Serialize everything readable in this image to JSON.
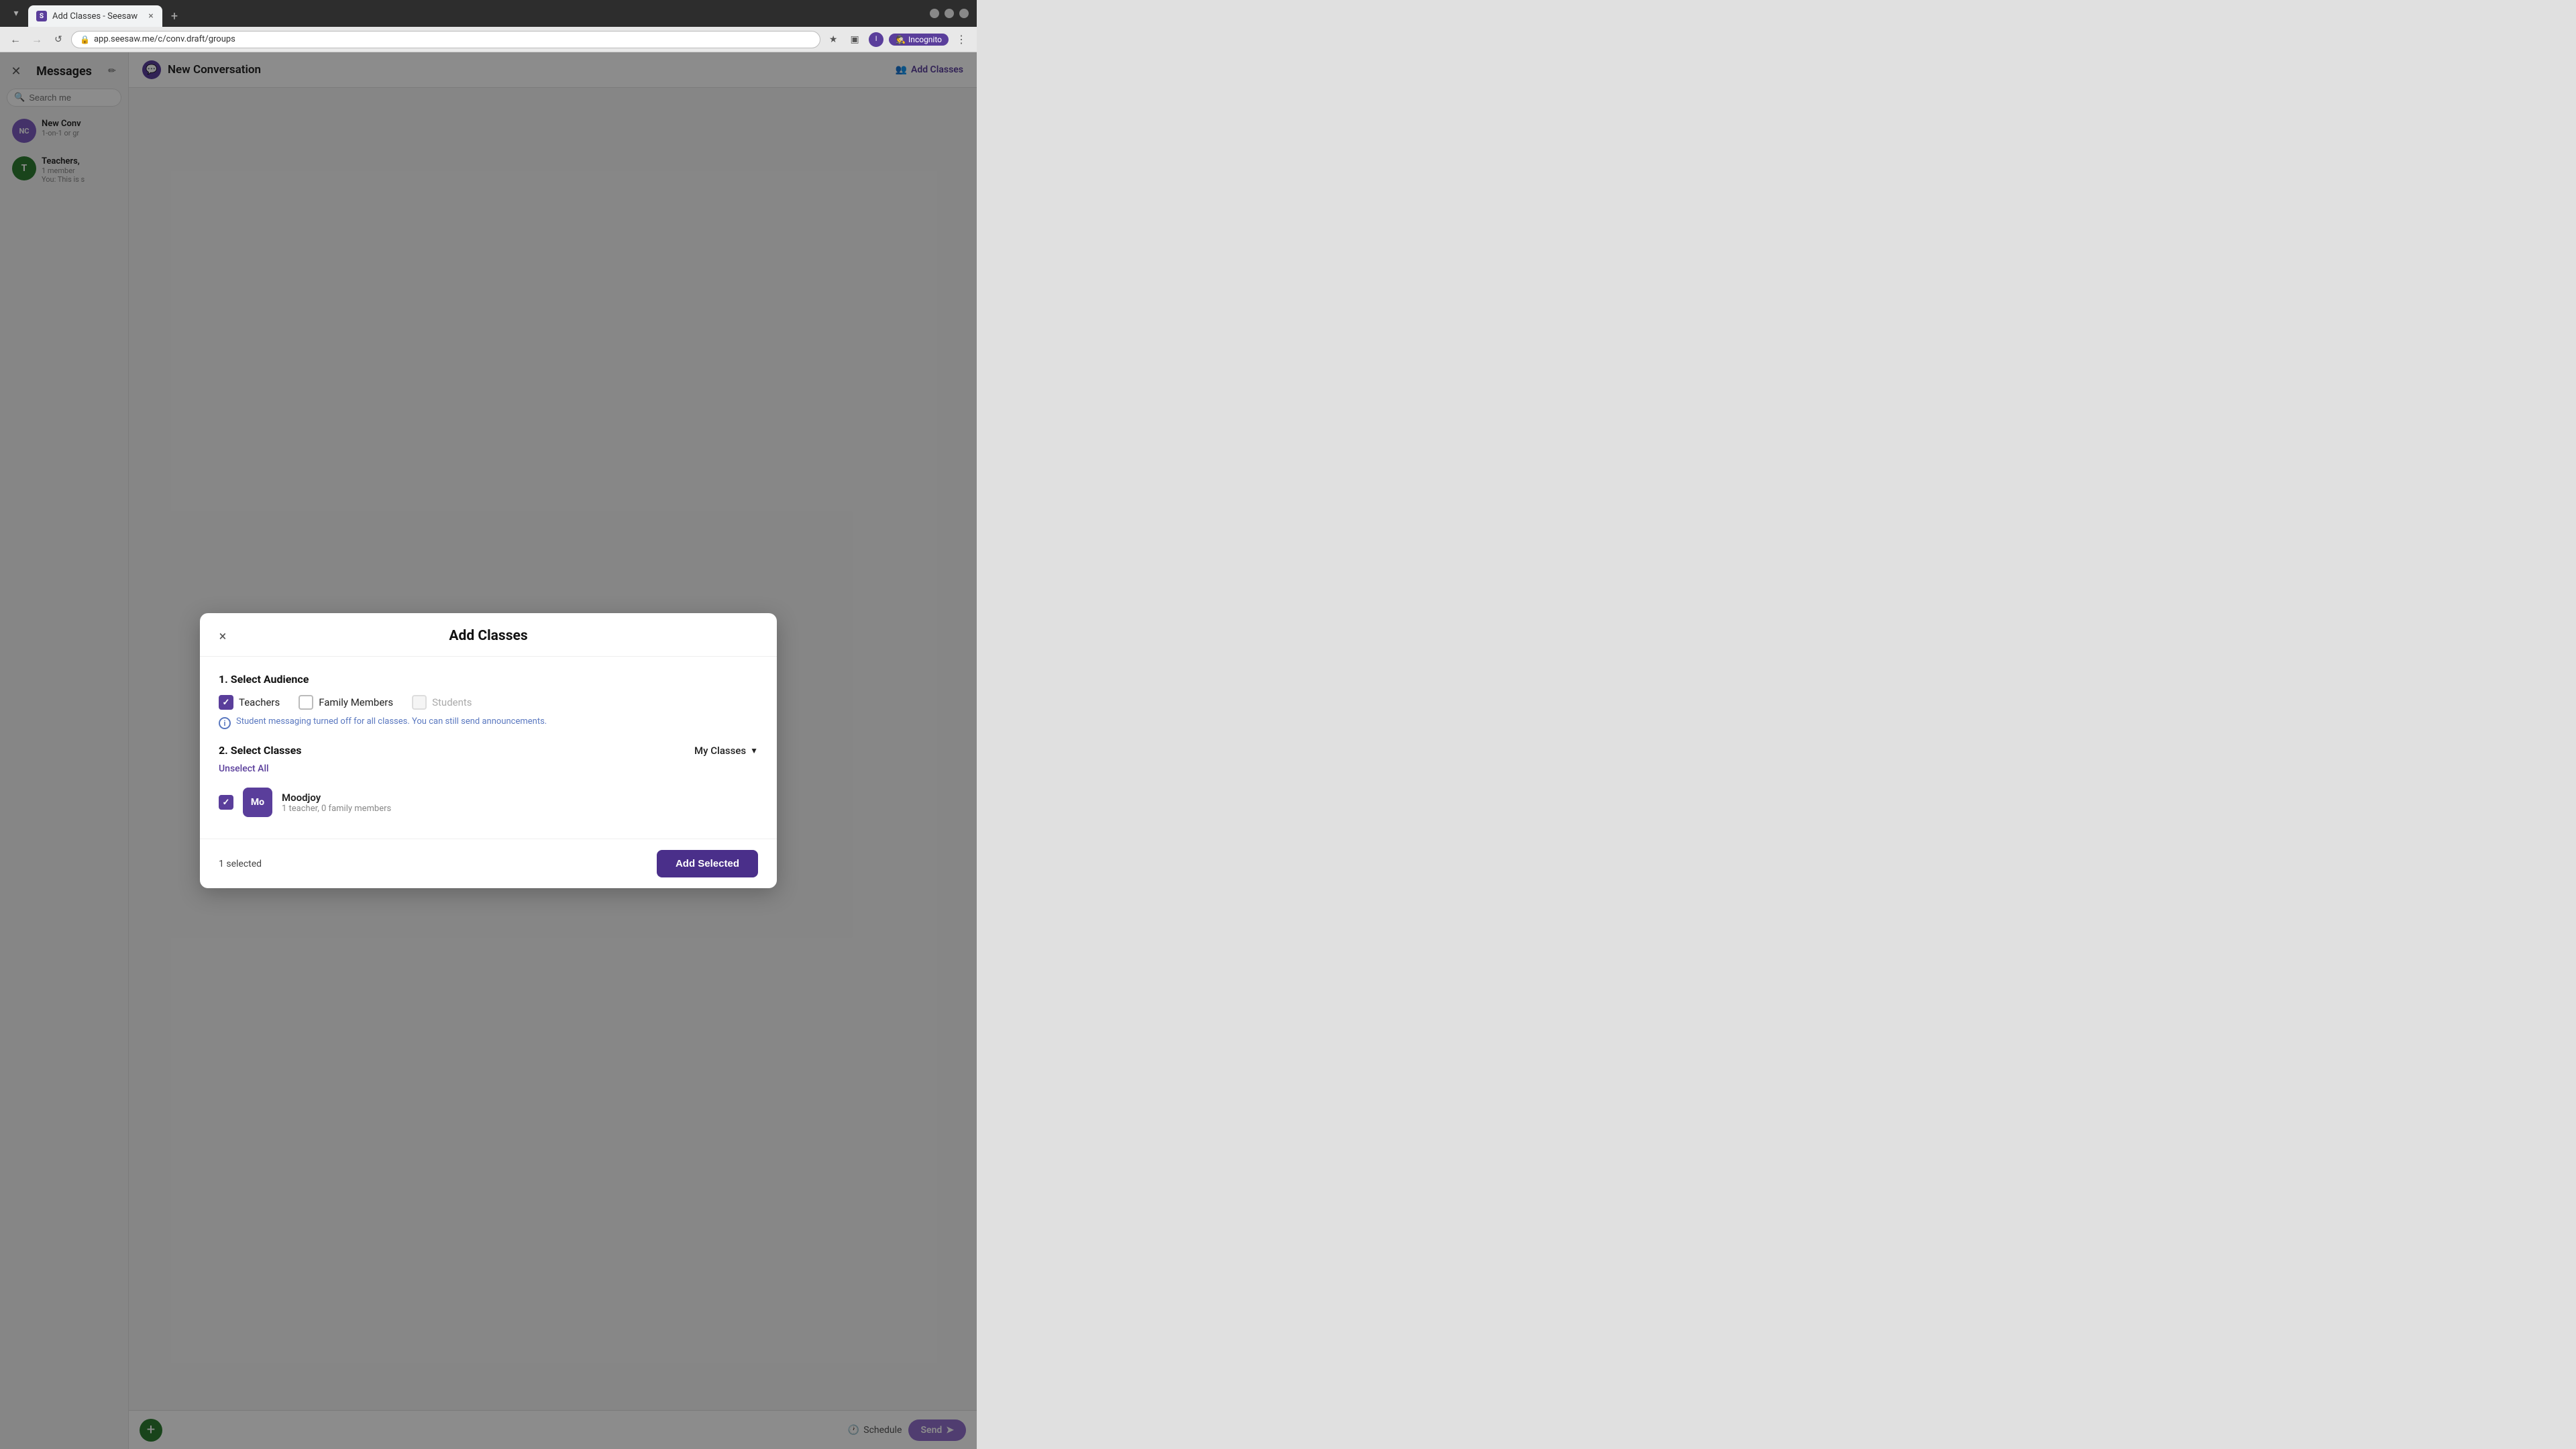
{
  "browser": {
    "tab_title": "Add Classes - Seesaw",
    "url": "app.seesaw.me/c/conv.draft/groups",
    "favicon_letter": "S",
    "close_label": "×",
    "new_tab_label": "+",
    "nav_back": "←",
    "nav_forward": "→",
    "nav_refresh": "↻",
    "incognito_label": "Incognito",
    "star_icon": "☆",
    "ext_icon": "⧉",
    "menu_icon": "⋮",
    "window_min": "─",
    "window_max": "□",
    "window_close": "×"
  },
  "sidebar": {
    "title": "Messages",
    "close_icon": "×",
    "compose_icon": "✏",
    "search_placeholder": "Search me",
    "conversations": [
      {
        "id": "new-conv",
        "avatar_letters": "NC",
        "name": "New Conv",
        "sub": "1-on-1 or gr",
        "avatar_color": "#7c5cbf"
      },
      {
        "id": "teachers",
        "avatar_letters": "T",
        "name": "Teachers,",
        "sub": "1 member",
        "note": "You: This is s",
        "avatar_color": "#2e7d32"
      }
    ]
  },
  "main": {
    "header_title": "New Conversation",
    "chat_icon": "💬",
    "add_classes_btn_label": "Add Classes",
    "add_classes_icon": "👥"
  },
  "bottom_bar": {
    "add_icon": "+",
    "schedule_icon": "🕐",
    "schedule_label": "Schedule",
    "send_label": "Send",
    "send_icon": "➤"
  },
  "modal": {
    "title": "Add Classes",
    "close_icon": "×",
    "section1_title": "1. Select Audience",
    "audience": {
      "teachers_label": "Teachers",
      "teachers_checked": true,
      "family_label": "Family Members",
      "family_checked": false,
      "students_label": "Students",
      "students_checked": false,
      "students_disabled": true
    },
    "info_text": "Student messaging turned off for all classes. You can still send announcements.",
    "section2_title": "2. Select Classes",
    "my_classes_label": "My Classes",
    "unselect_all_label": "Unselect All",
    "classes": [
      {
        "id": "moodjoy",
        "avatar_letters": "Mo",
        "name": "Moodjoy",
        "sub": "1 teacher, 0 family members",
        "checked": true,
        "avatar_color": "#5a3e9b"
      }
    ],
    "footer": {
      "selected_count": "1 selected",
      "add_selected_label": "Add Selected"
    }
  }
}
